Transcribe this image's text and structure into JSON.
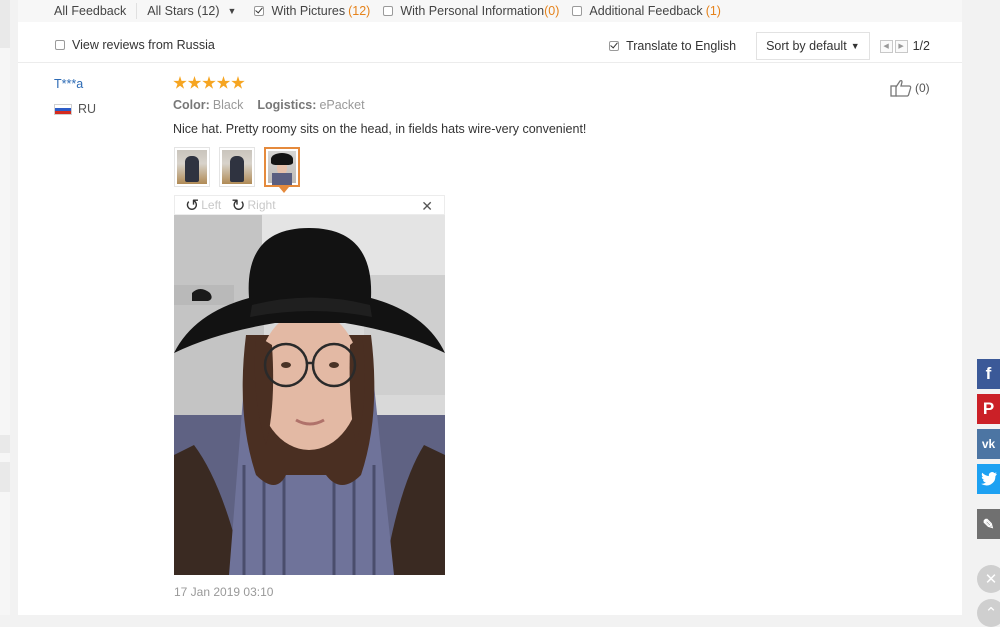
{
  "filters": {
    "all_feedback": "All Feedback",
    "all_stars": "All Stars (12)",
    "with_pictures_label": "With Pictures",
    "with_pictures_count": "(12)",
    "personal_info_label": "With Personal Information",
    "personal_info_count": "(0)",
    "additional_label": "Additional Feedback",
    "additional_count": "(1)"
  },
  "options": {
    "view_russia": "View reviews from Russia",
    "translate": "Translate to English",
    "sort": "Sort by default",
    "page": "1/2"
  },
  "review": {
    "user": "T***a",
    "country": "RU",
    "rating": 5,
    "color_label": "Color:",
    "color_value": "Black",
    "logistics_label": "Logistics:",
    "logistics_value": "ePacket",
    "text": "Nice hat. Pretty roomy sits on the head, in fields hats wire-very convenient!",
    "date": "17 Jan 2019 03:10",
    "helpful_count": "(0)"
  },
  "viewer": {
    "left_label": "Left",
    "right_label": "Right"
  },
  "colors": {
    "accent_orange": "#e58a3c",
    "star": "#f6a521",
    "username_blue": "#2d6bb5"
  },
  "share": [
    "facebook-icon",
    "pinterest-icon",
    "vk-icon",
    "twitter-icon",
    "edit-icon"
  ]
}
